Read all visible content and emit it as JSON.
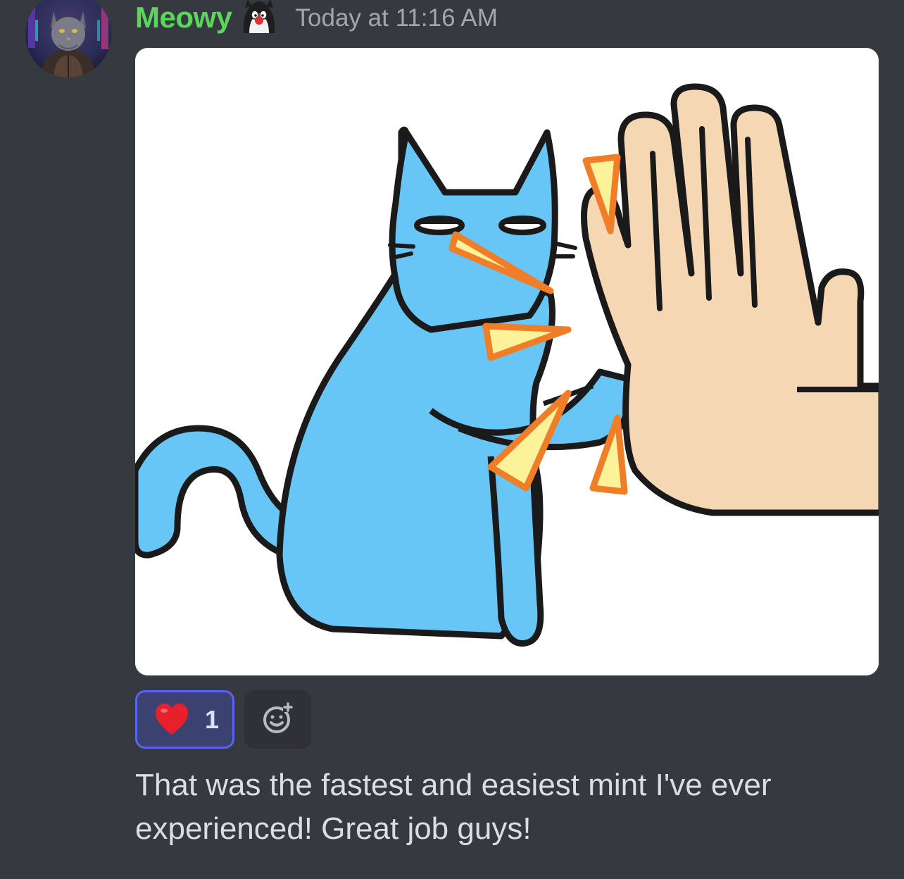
{
  "message": {
    "author": "Meowy",
    "timestamp": "Today at 11:16 AM",
    "text": "That was the fastest and easiest mint I've ever experienced! Great job guys!",
    "avatar_icon": "cat-avatar",
    "role_icon": "cartoon-cat-icon",
    "attachment": {
      "icon": "cat-high-five-sticker"
    }
  },
  "reactions": [
    {
      "emoji_icon": "red-heart-icon",
      "count": "1",
      "selected": true
    }
  ],
  "add_reaction": {
    "icon": "add-reaction-icon"
  },
  "colors": {
    "background": "#36393f",
    "username": "#5ad65a",
    "timestamp": "#a3a6aa",
    "reaction_border": "#5865f2",
    "reaction_bg": "#3c4270",
    "text": "#dcddde"
  }
}
